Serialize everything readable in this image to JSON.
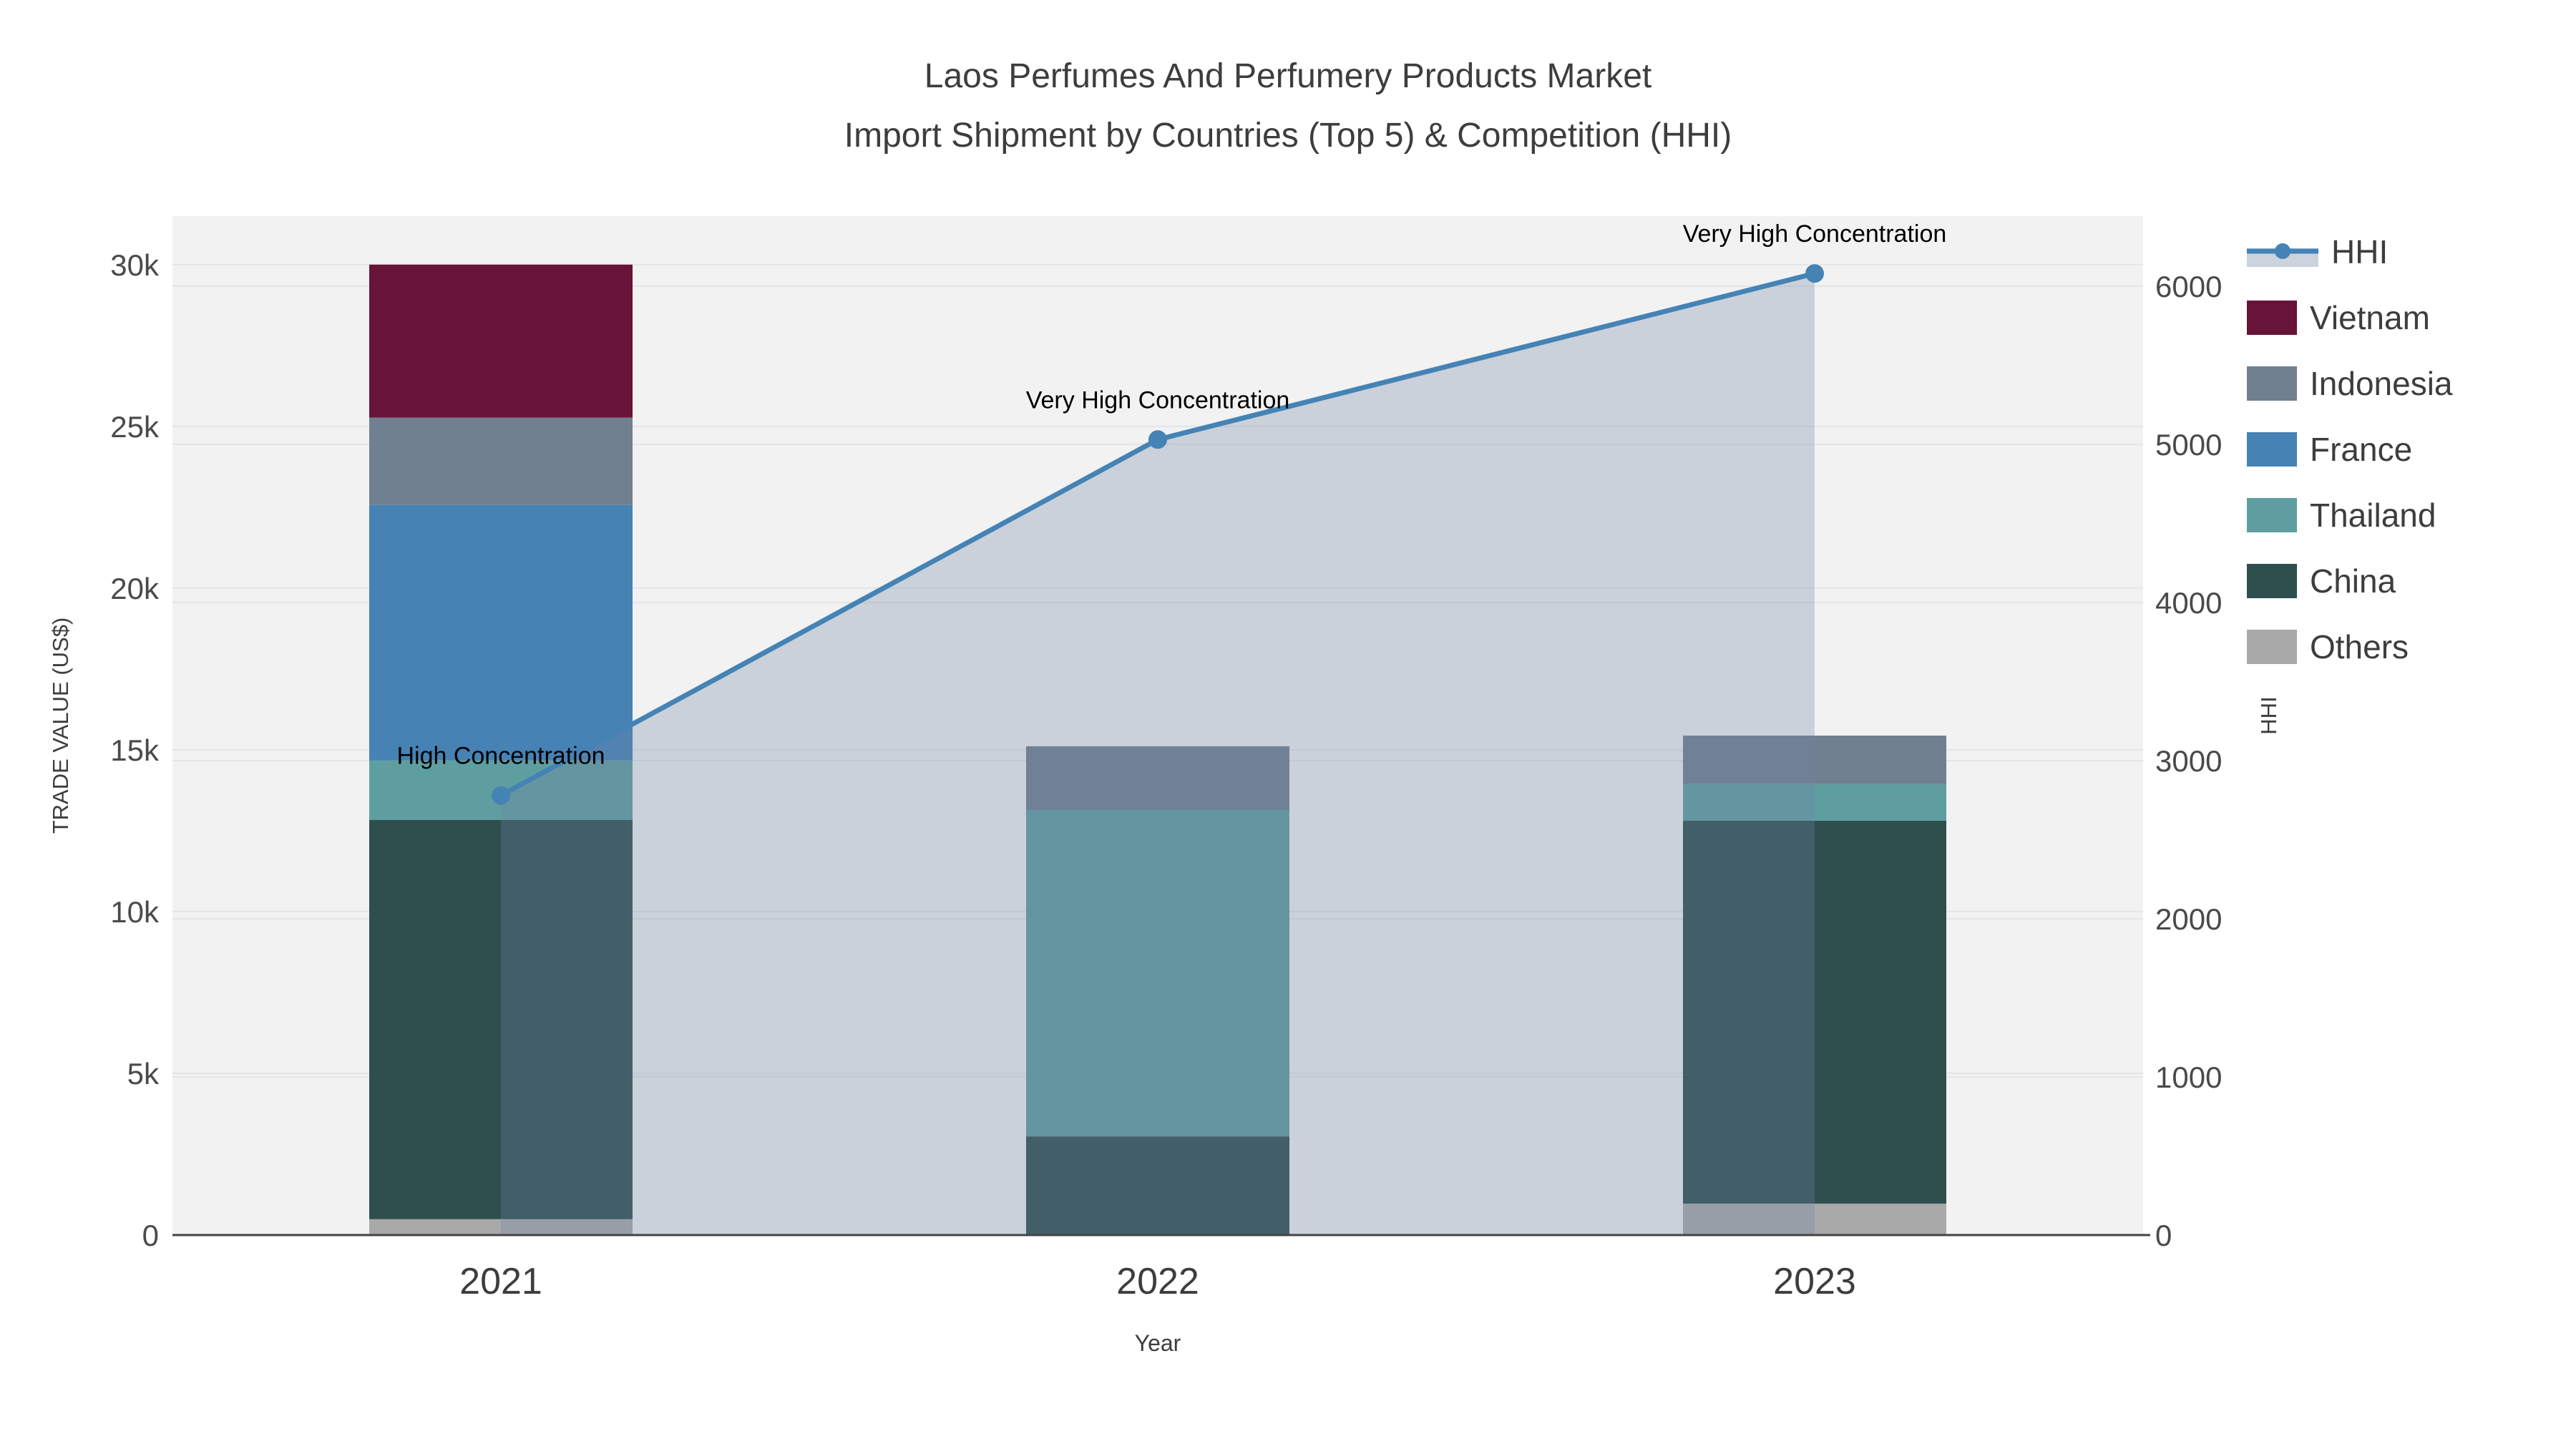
{
  "title": {
    "line1": "Laos Perfumes And Perfumery Products Market",
    "line2": "Import Shipment by Countries (Top 5) & Competition (HHI)"
  },
  "axes": {
    "x": {
      "title": "Year",
      "tick_labels": [
        "2021",
        "2022",
        "2023"
      ]
    },
    "y_left": {
      "title": "TRADE VALUE (US$)",
      "tick_labels": [
        "0",
        "5k",
        "10k",
        "15k",
        "20k",
        "25k",
        "30k"
      ],
      "tick_values": [
        0,
        5000,
        10000,
        15000,
        20000,
        25000,
        30000
      ]
    },
    "y_right": {
      "title": "HHI",
      "tick_labels": [
        "0",
        "1000",
        "2000",
        "3000",
        "4000",
        "5000",
        "6000"
      ],
      "tick_values": [
        0,
        1000,
        2000,
        3000,
        4000,
        5000,
        6000
      ]
    }
  },
  "legend": {
    "items": [
      {
        "label": "HHI",
        "color": "#4583b5",
        "band_color": "#ccd3dd"
      },
      {
        "label": "Vietnam",
        "color": "#681338"
      },
      {
        "label": "Indonesia",
        "color": "#708090"
      },
      {
        "label": "France",
        "color": "#4682b4"
      },
      {
        "label": "Thailand",
        "color": "#5f9ea0"
      },
      {
        "label": "China",
        "color": "#2f4f4f"
      },
      {
        "label": "Others",
        "color": "#a9a9a9"
      }
    ]
  },
  "chart_data": {
    "type": "bar+line",
    "title": "Laos Perfumes And Perfumery Products Market Import Shipment by Countries (Top 5) & Competition (HHI)",
    "xlabel": "Year",
    "ylabel_left": "TRADE VALUE (US$)",
    "ylabel_right": "HHI",
    "categories": [
      "2021",
      "2022",
      "2023"
    ],
    "bar_stack_order": "bottom to top",
    "bar_series": [
      {
        "name": "Others",
        "color": "#a9a9a9",
        "values": [
          490,
          0,
          970
        ]
      },
      {
        "name": "China",
        "color": "#2f4f4f",
        "values": [
          12340,
          3050,
          11840
        ]
      },
      {
        "name": "Thailand",
        "color": "#5f9ea0",
        "values": [
          1840,
          10090,
          1130
        ]
      },
      {
        "name": "France",
        "color": "#4682b4",
        "values": [
          7900,
          0,
          0
        ]
      },
      {
        "name": "Indonesia",
        "color": "#708090",
        "values": [
          2700,
          1970,
          1500
        ]
      },
      {
        "name": "Vietnam",
        "color": "#681338",
        "values": [
          4730,
          0,
          0
        ]
      }
    ],
    "bar_totals": [
      30000,
      15110,
      15440
    ],
    "line_series": {
      "name": "HHI",
      "color": "#4583b5",
      "marker": "circle",
      "area_fill": "rgba(113,134,166,0.30)",
      "values": [
        2780,
        5030,
        6080
      ]
    },
    "annotations": [
      "High Concentration",
      "Very High Concentration",
      "Very High Concentration"
    ],
    "ylim_left": [
      0,
      31500
    ],
    "ylim_right": [
      0,
      6443
    ],
    "grid": true,
    "legend_position": "right",
    "plot_bg": "#f2f2f3",
    "grid_color": "#e3e5e7",
    "axis_line_color": "#444444"
  }
}
